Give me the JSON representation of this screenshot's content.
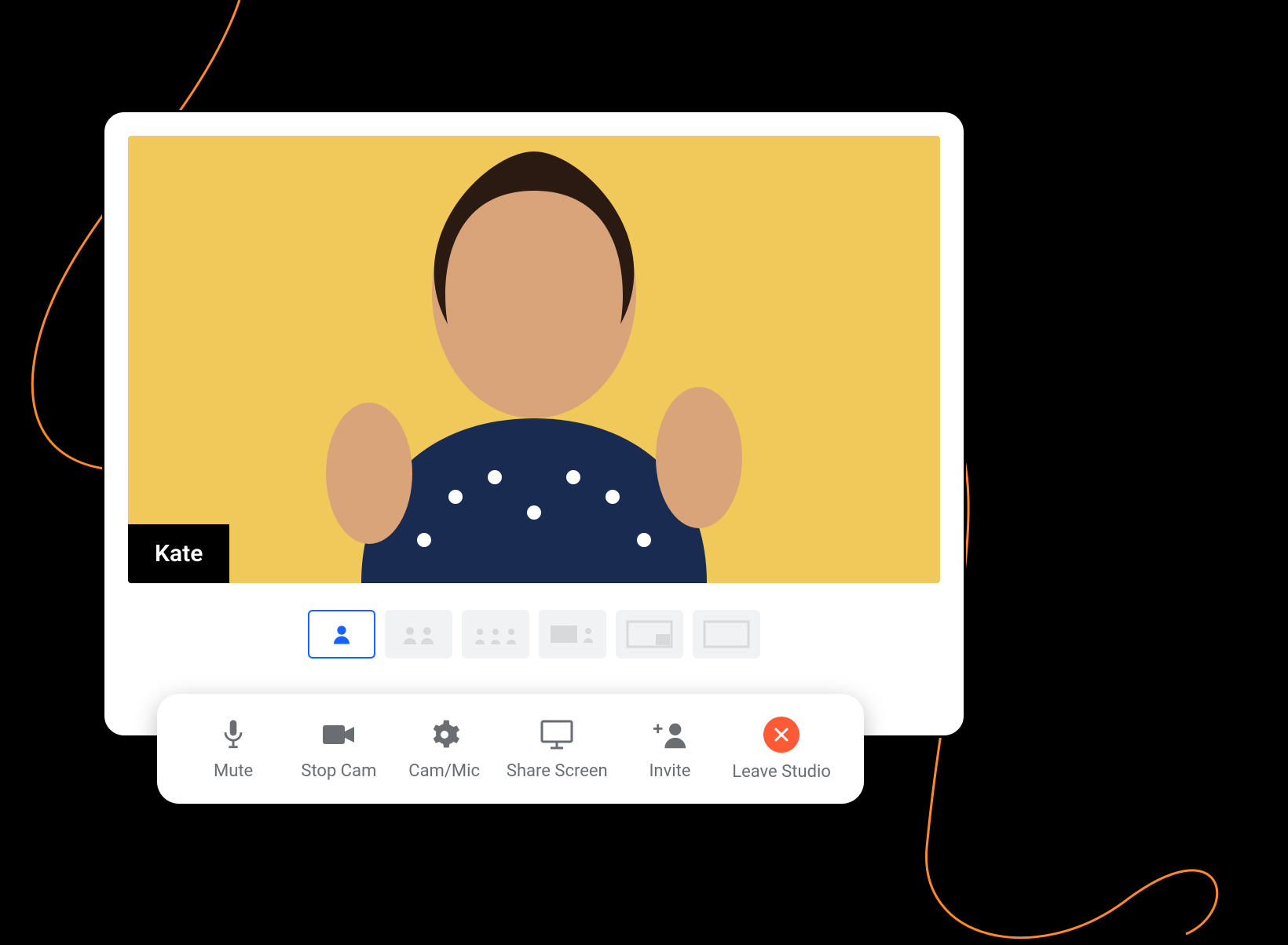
{
  "participant": {
    "name": "Kate"
  },
  "colors": {
    "video_bg": "#f0c95a",
    "accent": "#1463ff",
    "leave": "#ff5a36",
    "swirl": "#ff8a2a"
  },
  "layouts": {
    "selected_index": 0,
    "options": [
      {
        "id": "solo"
      },
      {
        "id": "two-up"
      },
      {
        "id": "three-up"
      },
      {
        "id": "screen-plus-one"
      },
      {
        "id": "pip"
      },
      {
        "id": "screen-only"
      }
    ]
  },
  "toolbar": {
    "mute": "Mute",
    "stop_cam": "Stop Cam",
    "cam_mic": "Cam/Mic",
    "share_screen": "Share Screen",
    "invite": "Invite",
    "leave": "Leave Studio"
  }
}
